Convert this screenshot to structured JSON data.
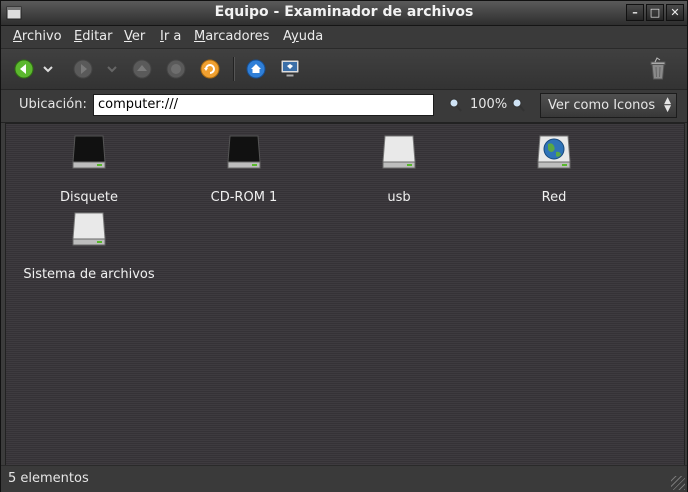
{
  "window": {
    "title": "Equipo - Examinador de archivos"
  },
  "titlebar_buttons": {
    "minimize": "–",
    "maximize": "□",
    "close": "✕"
  },
  "menu": [
    {
      "label": "Archivo",
      "mnemonic": "A"
    },
    {
      "label": "Editar",
      "mnemonic": "E"
    },
    {
      "label": "Ver",
      "mnemonic": "V"
    },
    {
      "label": "Ir a",
      "mnemonic": "I"
    },
    {
      "label": "Marcadores",
      "mnemonic": "M"
    },
    {
      "label": "Ayuda",
      "mnemonic": "y"
    }
  ],
  "toolbar": {
    "buttons": [
      "back-icon",
      "back-dropdown-icon",
      "forward-icon",
      "forward-dropdown-icon",
      "up-icon",
      "stop-icon",
      "reload-icon",
      "home-icon",
      "computer-icon",
      "trash-icon"
    ]
  },
  "location": {
    "label": "Ubicación:",
    "value": "computer:///",
    "zoom": "100%",
    "view_mode": "Ver como Iconos"
  },
  "items": [
    {
      "label": "Disquete",
      "icon": "floppy-drive-icon"
    },
    {
      "label": "CD-ROM 1",
      "icon": "cdrom-drive-icon"
    },
    {
      "label": "usb",
      "icon": "usb-drive-icon"
    },
    {
      "label": "Red",
      "icon": "network-icon"
    },
    {
      "label": "Sistema de archivos",
      "icon": "filesystem-drive-icon"
    }
  ],
  "status": {
    "text": "5 elementos"
  },
  "colors": {
    "accent_green": "#58b82b",
    "accent_orange": "#f0a030",
    "accent_blue": "#2f7fd8"
  }
}
